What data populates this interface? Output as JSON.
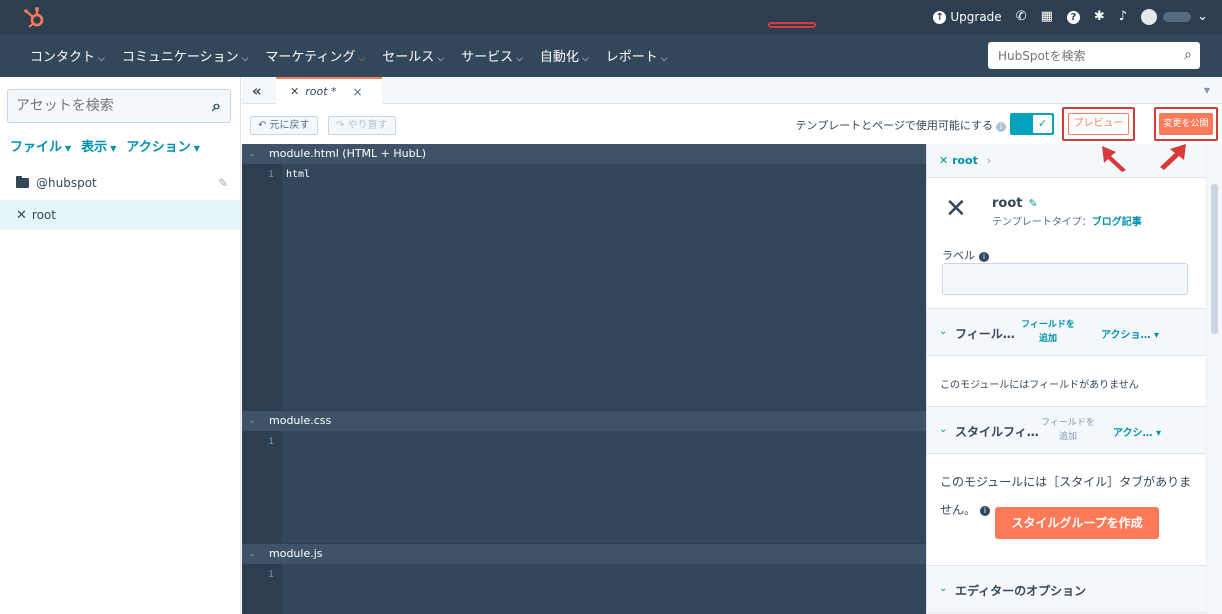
{
  "topbar": {
    "upgrade_label": "Upgrade",
    "icons": [
      "hubspot-logo",
      "upgrade-icon",
      "phone-icon",
      "marketplace-icon",
      "help-icon",
      "settings-icon",
      "notifications-icon",
      "avatar"
    ]
  },
  "nav": {
    "items": [
      {
        "label": "コンタクト"
      },
      {
        "label": "コミュニケーション"
      },
      {
        "label": "マーケティング"
      },
      {
        "label": "セールス"
      },
      {
        "label": "サービス"
      },
      {
        "label": "自動化"
      },
      {
        "label": "レポート"
      }
    ],
    "active": "マーケティング",
    "search_placeholder": "HubSpotを検索"
  },
  "sidebar": {
    "search_placeholder": "アセットを検索",
    "menus": [
      {
        "label": "ファイル"
      },
      {
        "label": "表示"
      },
      {
        "label": "アクション"
      }
    ],
    "tree": [
      {
        "label": "@hubspot"
      },
      {
        "label": "root"
      }
    ]
  },
  "tabs": {
    "open_file": "root *",
    "close": "×"
  },
  "toolbar": {
    "undo_label": "元に戻す",
    "redo_label": "やり直す",
    "template_toggle_label": "テンプレートとページで使用可能にする",
    "preview_label": "プレビュー",
    "publish_label": "変更を公開"
  },
  "editor": {
    "sections": [
      {
        "title": "module.html (HTML + HubL)",
        "lines": [
          "1"
        ],
        "code": "html"
      },
      {
        "title": "module.css",
        "lines": [
          "1"
        ],
        "code": ""
      },
      {
        "title": "module.js",
        "lines": [
          "1"
        ],
        "code": ""
      }
    ]
  },
  "right_panel": {
    "breadcrumb": "root",
    "module_name": "root",
    "template_type_label": "テンプレートタイプ：",
    "template_type_value": "ブログ記事",
    "label_field_label": "ラベル",
    "fields_section": {
      "title": "フィール…",
      "add_label": "フィールドを追加",
      "actions_label": "アクショ…",
      "empty_message": "このモジュールにはフィールドがありません"
    },
    "style_section": {
      "title": "スタイルフィ…",
      "add_label": "フィールドを追加",
      "actions_label": "アクシ…",
      "empty_message": "このモジュールには［スタイル］タブがありません。",
      "create_button": "スタイルグループを作成"
    },
    "editor_options_title": "エディターのオプション"
  },
  "colors": {
    "topbar": "#2d3e50",
    "navbar": "#33475b",
    "accent": "#ff7a59",
    "link": "#0091ae",
    "highlight_box": "#d63a3a",
    "toggle_on": "#00a4bd"
  }
}
